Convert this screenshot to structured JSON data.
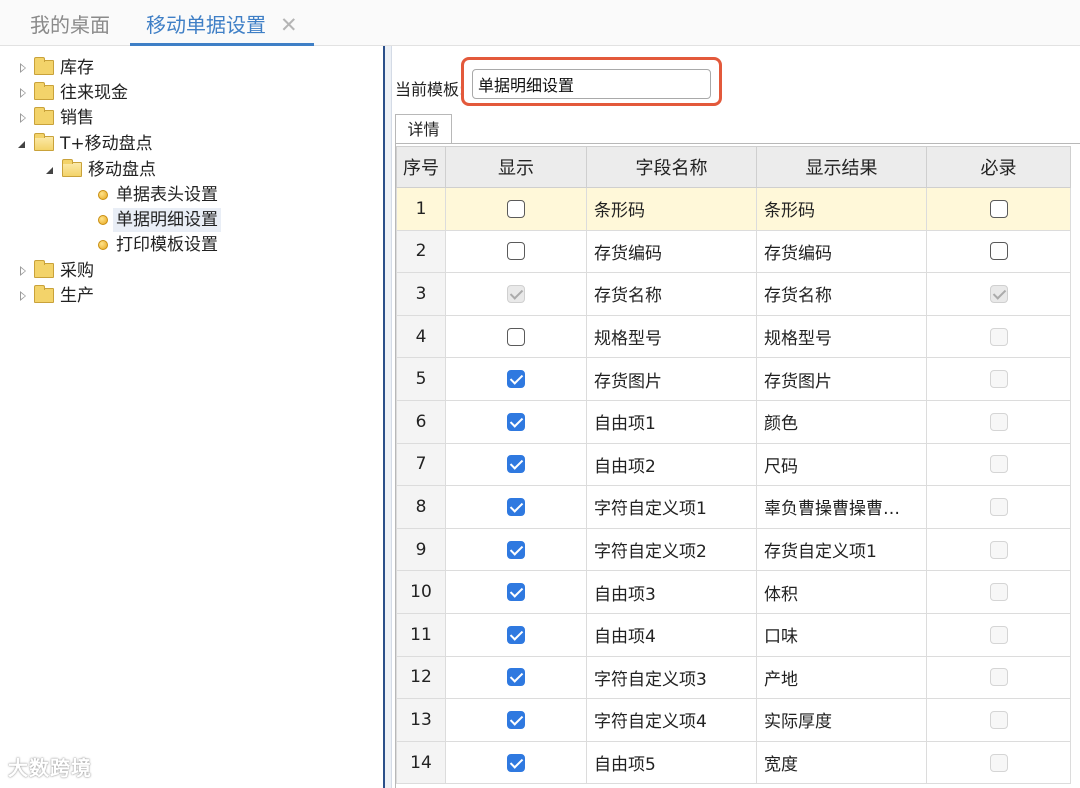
{
  "tabs": {
    "desktop": "我的桌面",
    "active": "移动单据设置",
    "close_symbol": "✕"
  },
  "tree": {
    "inventory": "库存",
    "cash": "往来现金",
    "sales": "销售",
    "mobile_count": "T+移动盘点",
    "mobile_count_sub": "移动盘点",
    "header_settings": "单据表头设置",
    "detail_settings": "单据明细设置",
    "print_settings": "打印模板设置",
    "purchase": "采购",
    "production": "生产"
  },
  "template": {
    "label": "当前模板:",
    "value": "单据明细设置",
    "detail_tab": "详情"
  },
  "columns": {
    "num": "序号",
    "show": "显示",
    "field": "字段名称",
    "result": "显示结果",
    "required": "必录"
  },
  "rows": [
    {
      "num": "1",
      "show": "off",
      "field": "条形码",
      "result": "条形码",
      "req": "off"
    },
    {
      "num": "2",
      "show": "off",
      "field": "存货编码",
      "result": "存货编码",
      "req": "off"
    },
    {
      "num": "3",
      "show": "disabled-on",
      "field": "存货名称",
      "result": "存货名称",
      "req": "disabled-on"
    },
    {
      "num": "4",
      "show": "off",
      "field": "规格型号",
      "result": "规格型号",
      "req": "disabled"
    },
    {
      "num": "5",
      "show": "on",
      "field": "存货图片",
      "result": "存货图片",
      "req": "disabled"
    },
    {
      "num": "6",
      "show": "on",
      "field": "自由项1",
      "result": "颜色",
      "req": "disabled"
    },
    {
      "num": "7",
      "show": "on",
      "field": "自由项2",
      "result": "尺码",
      "req": "disabled"
    },
    {
      "num": "8",
      "show": "on",
      "field": "字符自定义项1",
      "result": "辜负曹操曹操曹…",
      "req": "disabled"
    },
    {
      "num": "9",
      "show": "on",
      "field": "字符自定义项2",
      "result": "存货自定义项1",
      "req": "disabled"
    },
    {
      "num": "10",
      "show": "on",
      "field": "自由项3",
      "result": "体积",
      "req": "disabled"
    },
    {
      "num": "11",
      "show": "on",
      "field": "自由项4",
      "result": "口味",
      "req": "disabled"
    },
    {
      "num": "12",
      "show": "on",
      "field": "字符自定义项3",
      "result": "产地",
      "req": "disabled"
    },
    {
      "num": "13",
      "show": "on",
      "field": "字符自定义项4",
      "result": "实际厚度",
      "req": "disabled"
    },
    {
      "num": "14",
      "show": "on",
      "field": "自由项5",
      "result": "宽度",
      "req": "disabled"
    }
  ],
  "watermark": "大数跨境"
}
